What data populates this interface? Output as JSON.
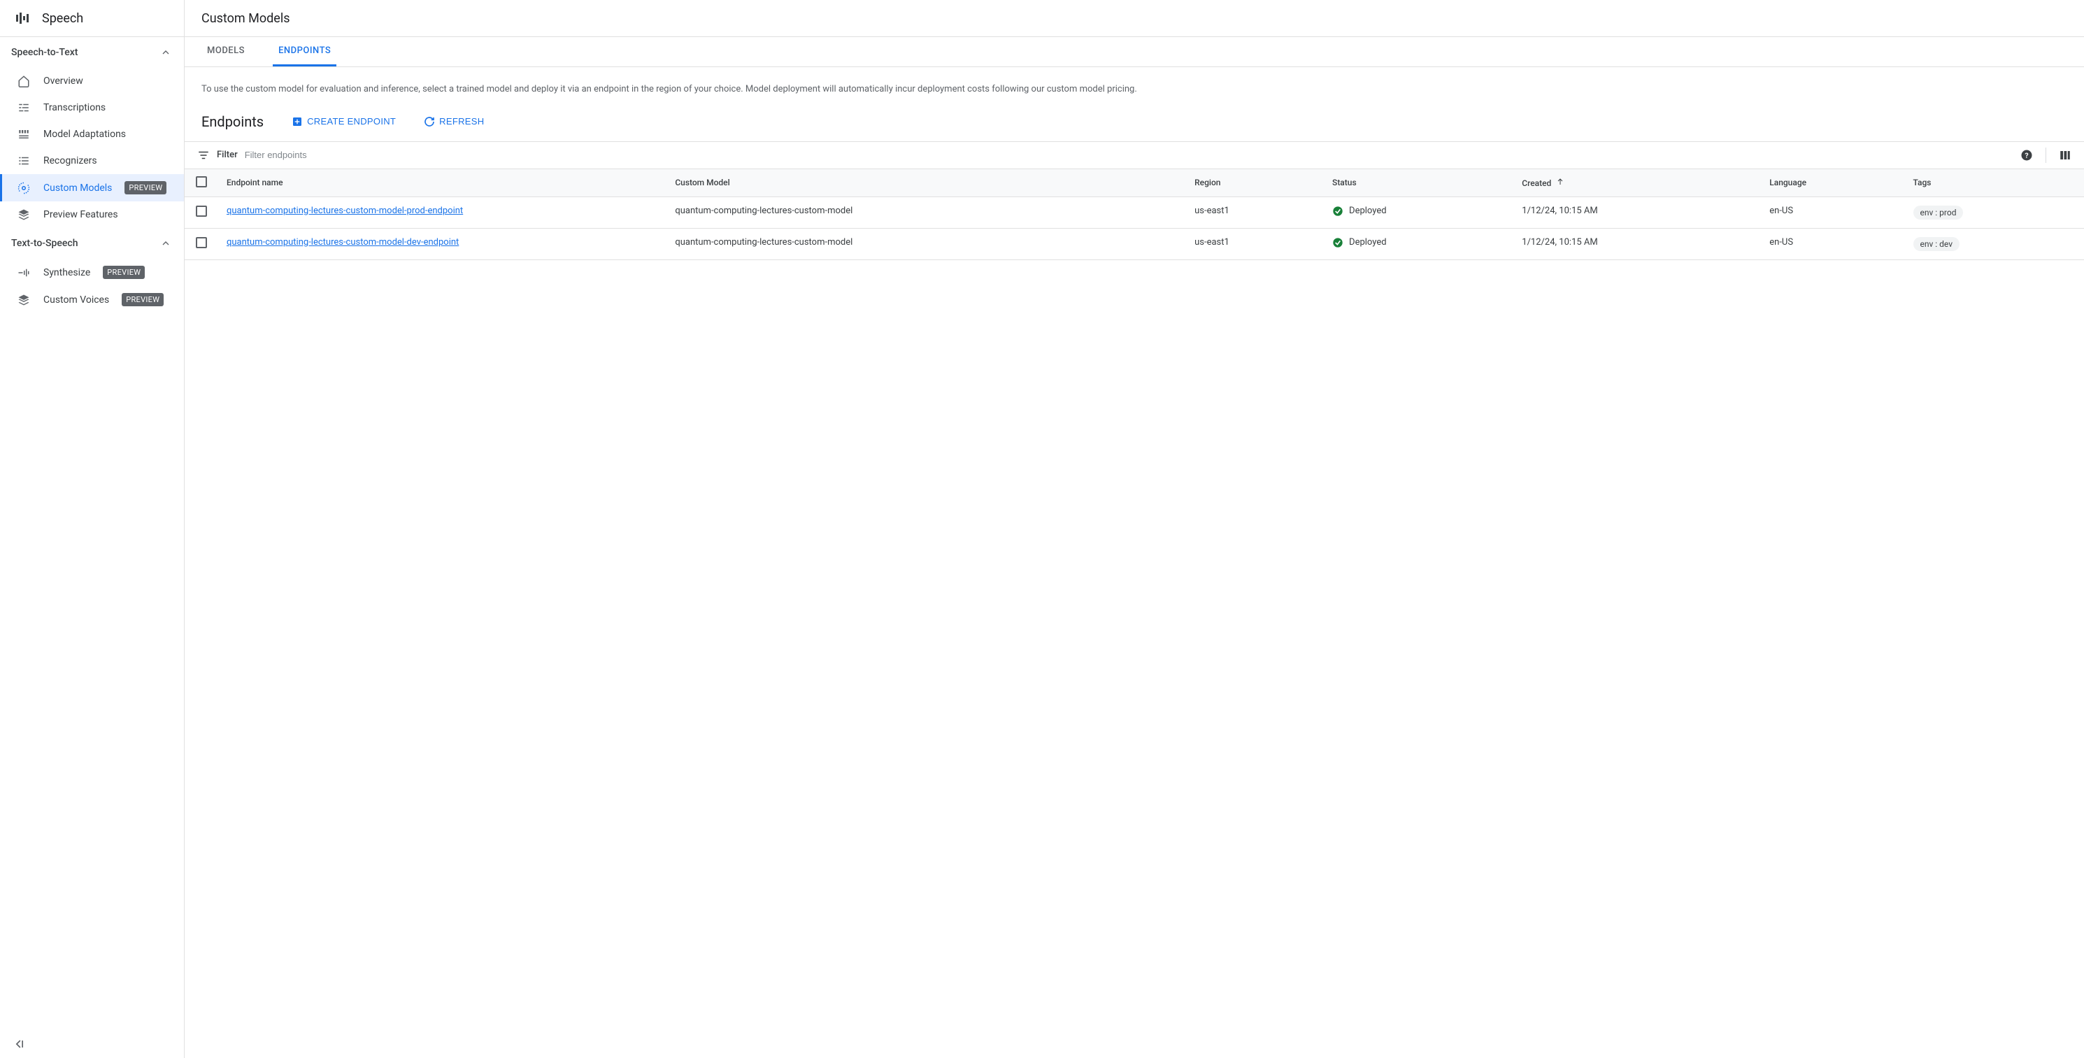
{
  "sidebar": {
    "title": "Speech",
    "sections": [
      {
        "label": "Speech-to-Text",
        "items": [
          {
            "label": "Overview",
            "icon": "home"
          },
          {
            "label": "Transcriptions",
            "icon": "transcriptions"
          },
          {
            "label": "Model Adaptations",
            "icon": "adaptations"
          },
          {
            "label": "Recognizers",
            "icon": "recognizers"
          },
          {
            "label": "Custom Models",
            "icon": "custom-models",
            "badge": "PREVIEW",
            "active": true
          },
          {
            "label": "Preview Features",
            "icon": "layers"
          }
        ]
      },
      {
        "label": "Text-to-Speech",
        "items": [
          {
            "label": "Synthesize",
            "icon": "synthesize",
            "badge": "PREVIEW"
          },
          {
            "label": "Custom Voices",
            "icon": "layers",
            "badge": "PREVIEW"
          }
        ]
      }
    ]
  },
  "page": {
    "title": "Custom Models",
    "tabs": [
      {
        "label": "MODELS",
        "active": false
      },
      {
        "label": "ENDPOINTS",
        "active": true
      }
    ],
    "description": "To use the custom model for evaluation and inference, select a trained model and deploy it via an endpoint in the region of your choice. Model deployment will automatically incur deployment costs following our custom model pricing.",
    "section_title": "Endpoints",
    "create_label": "CREATE ENDPOINT",
    "refresh_label": "REFRESH",
    "filter_label": "Filter",
    "filter_placeholder": "Filter endpoints"
  },
  "table": {
    "columns": [
      "Endpoint name",
      "Custom Model",
      "Region",
      "Status",
      "Created",
      "Language",
      "Tags"
    ],
    "sort_col": "Created",
    "rows": [
      {
        "endpoint_name": "quantum-computing-lectures-custom-model-prod-endpoint",
        "custom_model": "quantum-computing-lectures-custom-model",
        "region": "us-east1",
        "status": "Deployed",
        "created": "1/12/24, 10:15 AM",
        "language": "en-US",
        "tag": "env : prod"
      },
      {
        "endpoint_name": "quantum-computing-lectures-custom-model-dev-endpoint",
        "custom_model": "quantum-computing-lectures-custom-model",
        "region": "us-east1",
        "status": "Deployed",
        "created": "1/12/24, 10:15 AM",
        "language": "en-US",
        "tag": "env : dev"
      }
    ]
  }
}
